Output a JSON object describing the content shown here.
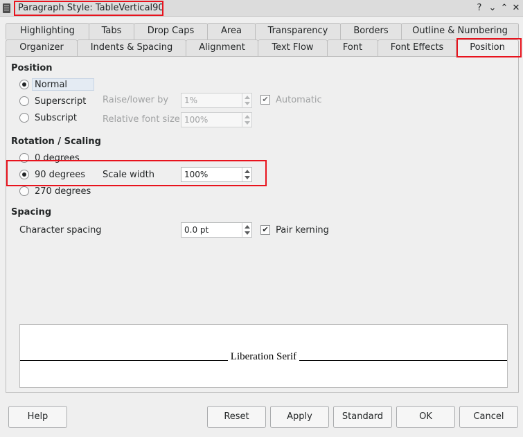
{
  "window": {
    "title": "Paragraph Style: TableVertical90",
    "controls": {
      "help": "?",
      "minimize": "⌄",
      "maximize": "⌃",
      "close": "✕"
    }
  },
  "tabs_row1": [
    "Highlighting",
    "Tabs",
    "Drop Caps",
    "Area",
    "Transparency",
    "Borders",
    "Outline & Numbering"
  ],
  "tabs_row2": [
    "Organizer",
    "Indents & Spacing",
    "Alignment",
    "Text Flow",
    "Font",
    "Font Effects",
    "Position"
  ],
  "active_tab": "Position",
  "position": {
    "title": "Position",
    "normal": "Normal",
    "superscript": "Superscript",
    "subscript": "Subscript",
    "selected": "Normal",
    "raise_lower_label": "Raise/lower by",
    "raise_lower_value": "1%",
    "automatic_label": "Automatic",
    "automatic_checked": true,
    "relative_size_label": "Relative font size",
    "relative_size_value": "100%"
  },
  "rotation": {
    "title": "Rotation / Scaling",
    "deg0": "0 degrees",
    "deg90": "90 degrees",
    "deg270": "270 degrees",
    "selected": "90 degrees",
    "scale_width_label": "Scale width",
    "scale_width_value": "100%"
  },
  "spacing": {
    "title": "Spacing",
    "char_spacing_label": "Character spacing",
    "char_spacing_value": "0.0 pt",
    "pair_kerning_label": "Pair kerning",
    "pair_kerning_checked": true
  },
  "preview": {
    "text": "Liberation Serif"
  },
  "buttons": {
    "help": "Help",
    "reset": "Reset",
    "apply": "Apply",
    "standard": "Standard",
    "ok": "OK",
    "cancel": "Cancel"
  },
  "colors": {
    "highlight": "#e8131d",
    "checkmark": "✔"
  }
}
